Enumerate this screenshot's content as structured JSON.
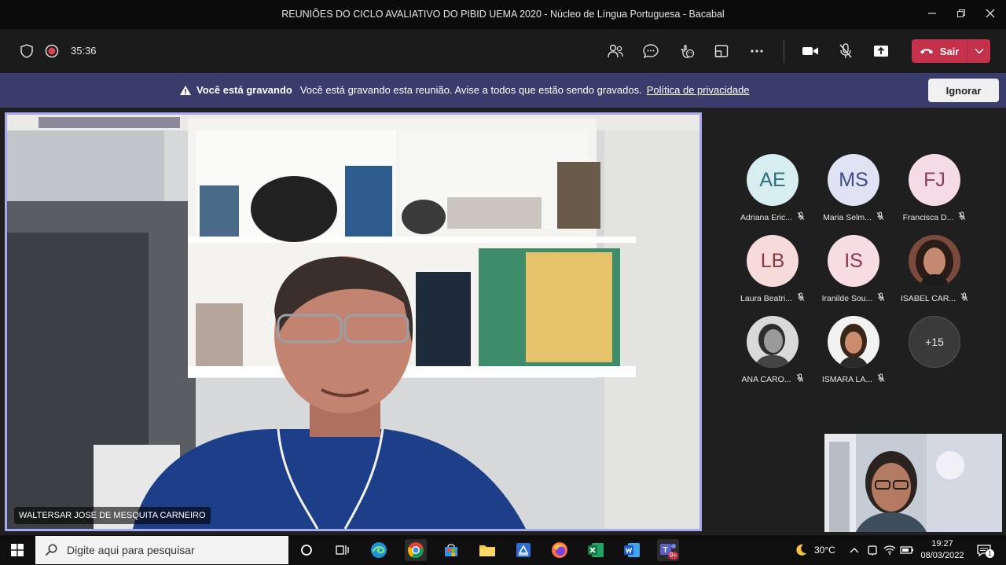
{
  "window": {
    "title": "REUNIÕES DO CICLO AVALIATIVO DO PIBID UEMA 2020 - Núcleo de Língua Portuguesa - Bacabal"
  },
  "toolbar": {
    "timer": "35:36",
    "leave_label": "Sair"
  },
  "banner": {
    "bold_text": "Você está gravando",
    "message": "Você está gravando esta reunião. Avise a todos que estão sendo gravados.",
    "link": "Política de privacidade",
    "ignore_label": "Ignorar"
  },
  "main_video": {
    "speaker_name": "WALTERSAR JOSE DE MESQUITA CARNEIRO"
  },
  "participants": [
    {
      "initials": "AE",
      "name": "Adriana Eric...",
      "bg": "#d7eef0",
      "fg": "#2d6f78"
    },
    {
      "initials": "MS",
      "name": "Maria Selm...",
      "bg": "#dfe3f3",
      "fg": "#3d4b8a"
    },
    {
      "initials": "FJ",
      "name": "Francisca D...",
      "bg": "#f4dbe6",
      "fg": "#8a3d60"
    },
    {
      "initials": "LB",
      "name": "Laura Beatri...",
      "bg": "#f7dada",
      "fg": "#8a3a3a"
    },
    {
      "initials": "IS",
      "name": "Iranilde Sou...",
      "bg": "#f7dde3",
      "fg": "#8d3450"
    },
    {
      "initials": "",
      "name": "ISABEL CAR...",
      "photo": true
    },
    {
      "initials": "",
      "name": "ANA CARO...",
      "photo": true
    },
    {
      "initials": "",
      "name": "ISMARA LA...",
      "photo": true
    }
  ],
  "more_participants": "+15",
  "taskbar": {
    "search_placeholder": "Digite aqui para pesquisar",
    "temperature": "30°C",
    "time": "19:27",
    "date": "08/03/2022",
    "teams_badge": "9+",
    "notification_count": "1"
  },
  "colors": {
    "banner": "#3a3d6b",
    "leave": "#c4314b",
    "active_speaker_border": "#a4a9f0"
  }
}
